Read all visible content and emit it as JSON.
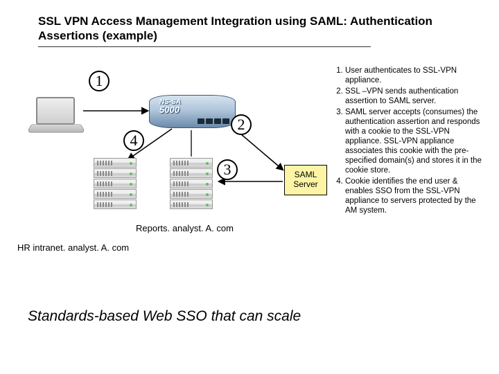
{
  "title": "SSL VPN Access Management Integration using SAML: Authentication Assertions  (example)",
  "appliance": {
    "brand": "NS-SA",
    "model": "5000"
  },
  "saml_box": "SAML Server",
  "step_circles": {
    "1": "1",
    "2": "2",
    "3": "3",
    "4": "4"
  },
  "domains": {
    "hr": "HR intranet. analyst. A. com",
    "reports": "Reports. analyst. A. com"
  },
  "steps": [
    "User authenticates to SSL-VPN appliance.",
    "SSL –VPN sends authentication assertion to SAML server.",
    "SAML server accepts (consumes) the authentication assertion and responds with a cookie to the SSL-VPN appliance. SSL-VPN appliance associates this cookie with the pre-specified domain(s) and stores it in the cookie store.",
    "Cookie identifies the end user & enables SSO  from the SSL-VPN appliance to servers protected by the AM system."
  ],
  "tagline": "Standards-based Web SSO that can scale"
}
